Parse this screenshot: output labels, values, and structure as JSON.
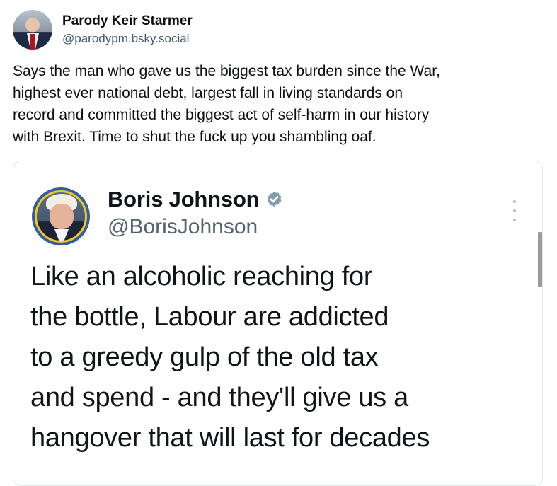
{
  "post": {
    "author": {
      "display_name": "Parody Keir Starmer",
      "handle": "@parodypm.bsky.social"
    },
    "text": "Says the man who gave us the biggest tax burden since the War,\nhighest ever national debt, largest fall in living standards on\nrecord and committed the biggest act of self-harm in our history\nwith Brexit. Time to shut the fuck up you shambling oaf."
  },
  "embed": {
    "author": {
      "display_name": "Boris Johnson",
      "handle": "@BorisJohnson",
      "verified": true
    },
    "icons": [
      "verified-badge-icon",
      "more-options-icon"
    ],
    "text": "Like an alcoholic reaching for\nthe bottle, Labour are addicted\nto a greedy gulp of the old tax\nand spend - and they'll give us a\nhangover that will last for decades"
  },
  "colors": {
    "text": "#0b0f14",
    "handle_blue": "#42576c",
    "embed_border": "#e2e6ea",
    "verified_badge": "#829aab"
  }
}
